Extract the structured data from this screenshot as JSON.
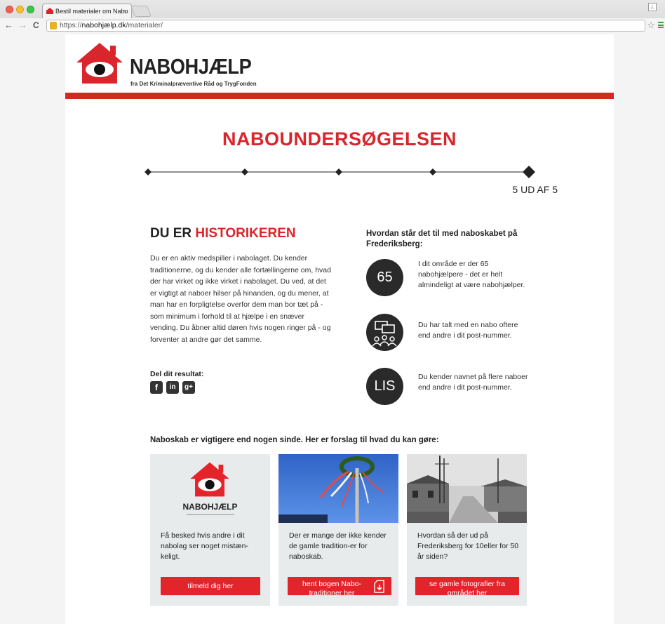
{
  "browser": {
    "tab_title": "Bestil materialer om Nabo",
    "tab_close": "×",
    "url_scheme": "https://",
    "url_host": "nabohjælp.dk",
    "url_path": "/materialer/",
    "back": "←",
    "forward": "→",
    "reload": "C",
    "star": "☆"
  },
  "header": {
    "logo_title": "NABOHJÆLP",
    "logo_subtitle": "fra Det Kriminalpræventive Råd og TrygFonden",
    "brand_color": "#d8262c"
  },
  "survey": {
    "title": "NABOUNDERSØGELSEN",
    "step_text": "5 UD AF 5",
    "steps_total": 5,
    "current_step": 5
  },
  "result": {
    "title_prefix": "DU ER ",
    "title_highlight": "HISTORIKEREN",
    "body": "Du er en aktiv medspiller i nabolaget. Du kender traditionerne, og du kender alle fortællingerne om, hvad der har virket og ikke virket i nabolaget. Du ved, at det er vigtigt at naboer hilser på hinanden, og du mener, at man har en forpligtelse overfor dem man bor tæt på - som minimum i forhold til at hjælpe i en snæver vending. Du åbner altid døren hvis nogen ringer på - og forventer at andre gør det samme.",
    "share_label": "Del dit resultat:",
    "share": [
      {
        "icon": "facebook-icon",
        "glyph": "f"
      },
      {
        "icon": "linkedin-icon",
        "glyph": "in"
      },
      {
        "icon": "googleplus-icon",
        "glyph": "g+"
      }
    ]
  },
  "stats": {
    "title": "Hvordan står det til med naboskabet på Frederiksberg:",
    "items": [
      {
        "circle": "65",
        "text": "I dit område er der 65 nabohjælpere - det er helt almindeligt at være nabohjælper."
      },
      {
        "circle": "",
        "icon": "people-chat-icon",
        "text": "Du har talt med en nabo oftere end andre i dit post-nummer."
      },
      {
        "circle": "LIS",
        "text": "Du kender navnet på flere naboer end andre i dit post-nummer."
      }
    ]
  },
  "tips": {
    "title": "Naboskab er vigtigere end nogen sinde. Her er forslag til hvad du kan gøre:",
    "cards": [
      {
        "image_logo": "NABOHJÆLP",
        "text": "Få besked hvis andre i dit nabolag ser noget mistæn-keligt.",
        "button": "tilmeld dig her"
      },
      {
        "text": "Der er mange der ikke kender de gamle tradition-er for naboskab.",
        "button": "hent bogen Nabo-traditioner her",
        "button_icon": "download-icon"
      },
      {
        "text": "Hvordan så der ud på Frederiksberg for 10eller for 50 år siden?",
        "button": "se gamle fotografier fra området her"
      }
    ]
  }
}
